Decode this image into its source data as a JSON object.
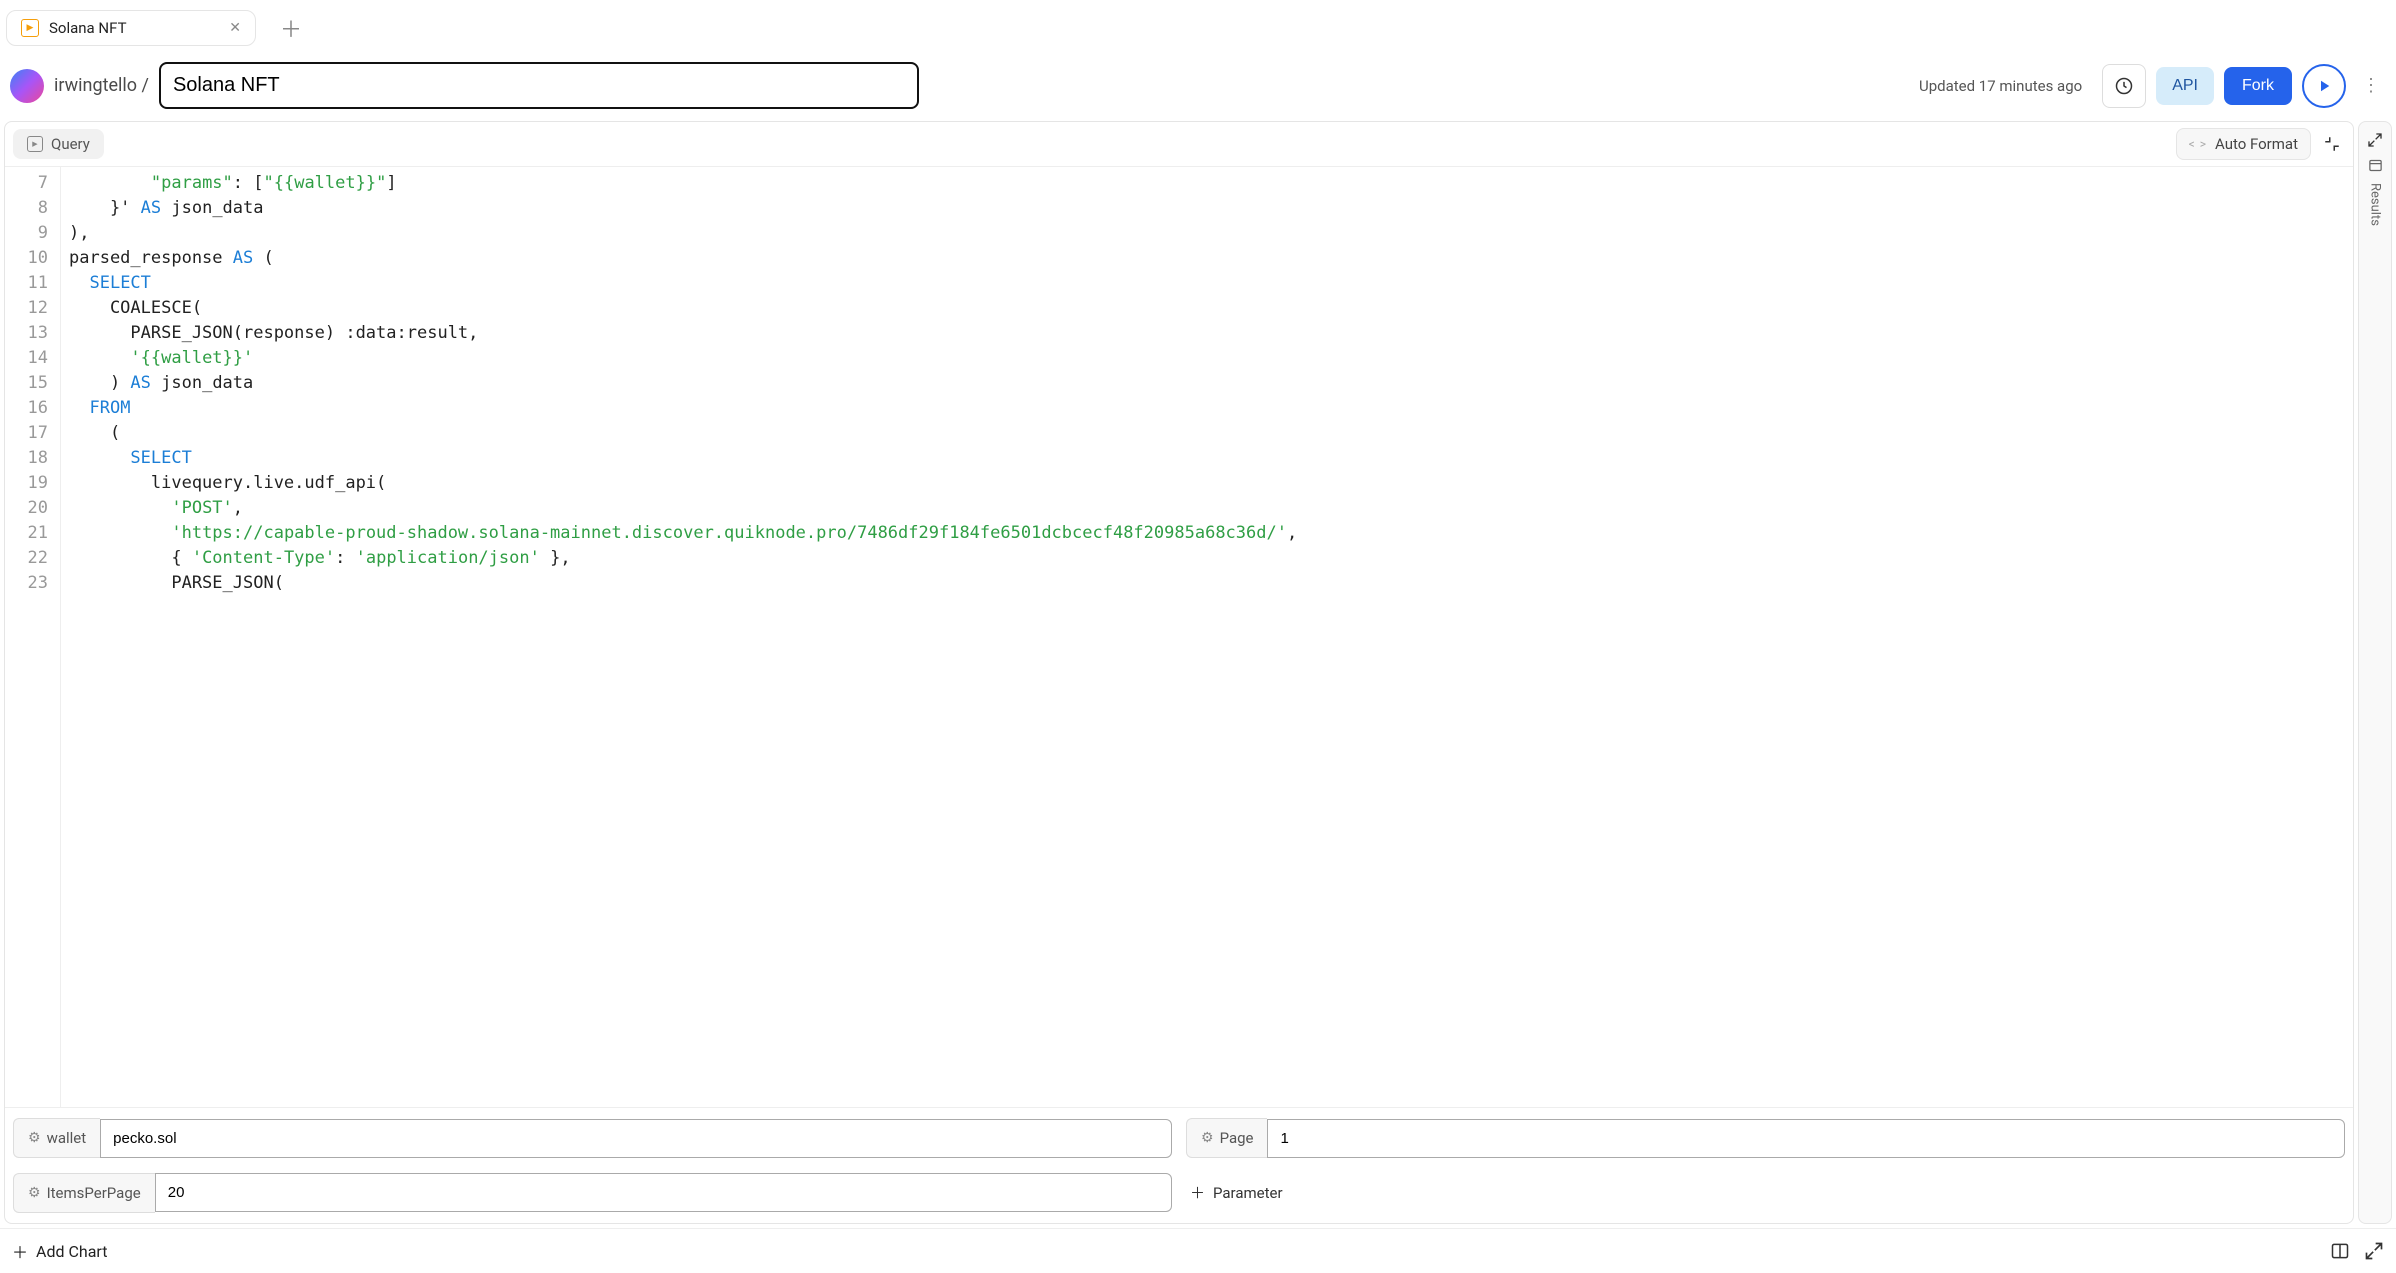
{
  "tab": {
    "title": "Solana NFT"
  },
  "header": {
    "user": "irwingtello",
    "title": "Solana NFT",
    "updated": "Updated 17 minutes ago",
    "api_label": "API",
    "fork_label": "Fork"
  },
  "editor": {
    "query_label": "Query",
    "autoformat_label": "Auto Format",
    "line_start": 7,
    "lines": [
      {
        "tokens": [
          {
            "t": "        ",
            "c": ""
          },
          {
            "t": "\"params\"",
            "c": "tok-str"
          },
          {
            "t": ": [",
            "c": ""
          },
          {
            "t": "\"{{wallet}}\"",
            "c": "tok-str"
          },
          {
            "t": "]",
            "c": ""
          }
        ]
      },
      {
        "tokens": [
          {
            "t": "    }' ",
            "c": ""
          },
          {
            "t": "AS",
            "c": "tok-kw"
          },
          {
            "t": " json_data",
            "c": ""
          }
        ]
      },
      {
        "tokens": [
          {
            "t": "),",
            "c": ""
          }
        ]
      },
      {
        "tokens": [
          {
            "t": "parsed_response ",
            "c": ""
          },
          {
            "t": "AS",
            "c": "tok-kw"
          },
          {
            "t": " (",
            "c": ""
          }
        ]
      },
      {
        "tokens": [
          {
            "t": "  ",
            "c": ""
          },
          {
            "t": "SELECT",
            "c": "tok-kw"
          }
        ]
      },
      {
        "tokens": [
          {
            "t": "    COALESCE(",
            "c": ""
          }
        ]
      },
      {
        "tokens": [
          {
            "t": "      PARSE_JSON(response) :data:result,",
            "c": ""
          }
        ]
      },
      {
        "tokens": [
          {
            "t": "      ",
            "c": ""
          },
          {
            "t": "'{{wallet}}'",
            "c": "tok-str"
          }
        ]
      },
      {
        "tokens": [
          {
            "t": "    ) ",
            "c": ""
          },
          {
            "t": "AS",
            "c": "tok-kw"
          },
          {
            "t": " json_data",
            "c": ""
          }
        ]
      },
      {
        "tokens": [
          {
            "t": "  ",
            "c": ""
          },
          {
            "t": "FROM",
            "c": "tok-kw"
          }
        ]
      },
      {
        "tokens": [
          {
            "t": "    (",
            "c": ""
          }
        ]
      },
      {
        "tokens": [
          {
            "t": "      ",
            "c": ""
          },
          {
            "t": "SELECT",
            "c": "tok-kw"
          }
        ]
      },
      {
        "tokens": [
          {
            "t": "        livequery.live.udf_api(",
            "c": ""
          }
        ]
      },
      {
        "tokens": [
          {
            "t": "          ",
            "c": ""
          },
          {
            "t": "'POST'",
            "c": "tok-str"
          },
          {
            "t": ",",
            "c": ""
          }
        ]
      },
      {
        "tokens": [
          {
            "t": "          ",
            "c": ""
          },
          {
            "t": "'https://capable-proud-shadow.solana-mainnet.discover.quiknode.pro/7486df29f184fe6501dcbcecf48f20985a68c36d/'",
            "c": "tok-str"
          },
          {
            "t": ",",
            "c": ""
          }
        ]
      },
      {
        "tokens": [
          {
            "t": "          { ",
            "c": ""
          },
          {
            "t": "'Content-Type'",
            "c": "tok-str"
          },
          {
            "t": ": ",
            "c": ""
          },
          {
            "t": "'application/json'",
            "c": "tok-str"
          },
          {
            "t": " },",
            "c": ""
          }
        ]
      },
      {
        "tokens": [
          {
            "t": "          PARSE_JSON(",
            "c": ""
          }
        ]
      }
    ]
  },
  "params": {
    "wallet_label": "wallet",
    "wallet_value": "pecko.sol",
    "page_label": "Page",
    "page_value": "1",
    "items_label": "ItemsPerPage",
    "items_value": "20",
    "add_label": "Parameter"
  },
  "side": {
    "results_label": "Results"
  },
  "footer": {
    "add_chart_label": "Add Chart"
  }
}
